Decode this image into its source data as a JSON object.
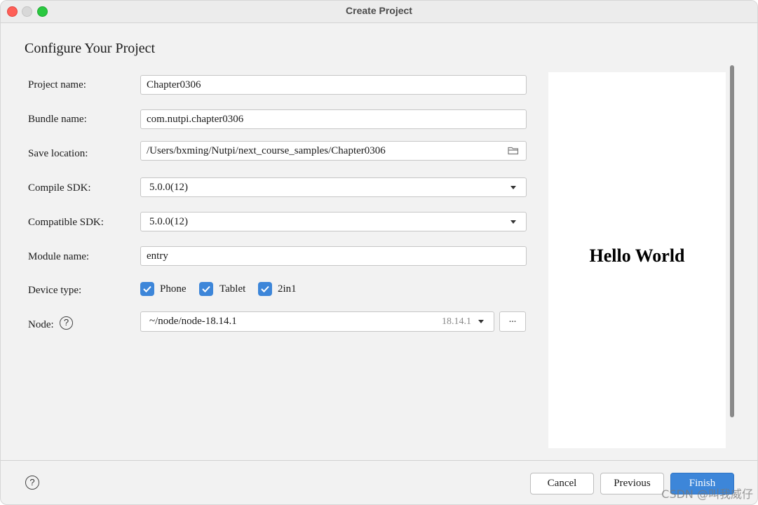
{
  "window": {
    "title": "Create Project"
  },
  "page": {
    "heading": "Configure Your Project"
  },
  "form": {
    "project_name": {
      "label": "Project name:",
      "value": "Chapter0306"
    },
    "bundle_name": {
      "label": "Bundle name:",
      "value": "com.nutpi.chapter0306"
    },
    "save_location": {
      "label": "Save location:",
      "value": "/Users/bxming/Nutpi/next_course_samples/Chapter0306"
    },
    "compile_sdk": {
      "label": "Compile SDK:",
      "value": "5.0.0(12)"
    },
    "compatible_sdk": {
      "label": "Compatible SDK:",
      "value": "5.0.0(12)"
    },
    "module_name": {
      "label": "Module name:",
      "value": "entry"
    },
    "device_type": {
      "label": "Device type:",
      "options": [
        {
          "label": "Phone",
          "checked": true
        },
        {
          "label": "Tablet",
          "checked": true
        },
        {
          "label": "2in1",
          "checked": true
        }
      ]
    },
    "node": {
      "label": "Node:",
      "value": "~/node/node-18.14.1",
      "version": "18.14.1",
      "browse_label": "...",
      "help_glyph": "?"
    }
  },
  "preview": {
    "text": "Hello World"
  },
  "footer": {
    "help_glyph": "?",
    "cancel_label": "Cancel",
    "previous_label": "Previous",
    "finish_label": "Finish"
  },
  "watermark": "CSDN @叫我威仔",
  "colors": {
    "accent": "#3d86d9",
    "background": "#f2f2f2",
    "preview_bg": "#ffffff"
  }
}
